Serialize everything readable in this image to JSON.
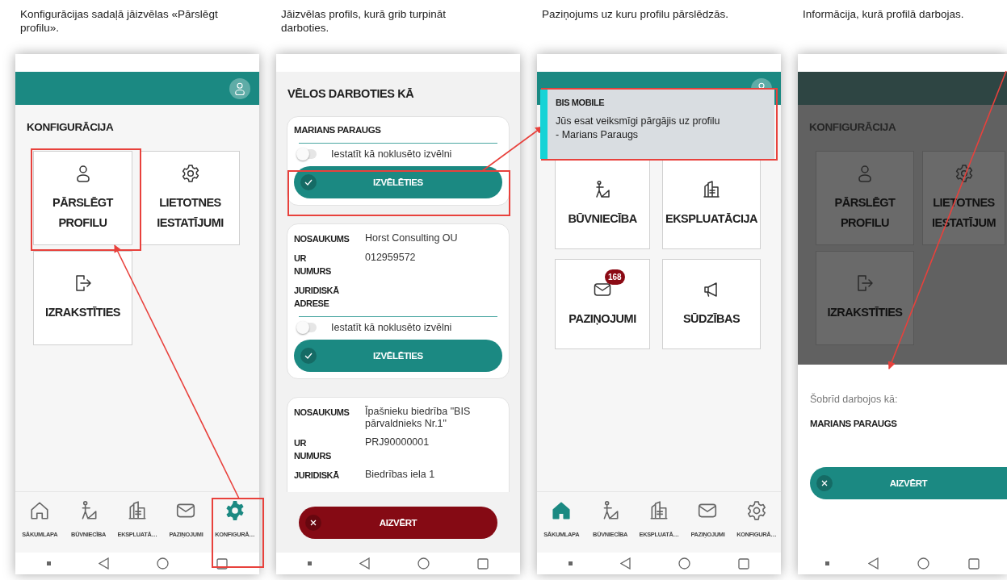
{
  "panels": [
    {
      "kind": "menu",
      "caption": "Konfigurācijas sadaļā jāizvēlas «Pārslēgt profilu».",
      "title": "KONFIGURĀCIJA",
      "tiles": [
        {
          "kind": "person",
          "label": "PĀRSLĒGT PROFILU"
        },
        {
          "kind": "gear",
          "label": "LIETOTNES IESTATĪJUMI"
        },
        {
          "kind": "logout",
          "label": "IZRAKSTĪTIES"
        }
      ],
      "nav": [
        {
          "kind": "home",
          "label": "SĀKUMLAPA",
          "selected": false
        },
        {
          "kind": "construction",
          "label": "BŪVNIECĪBA",
          "selected": false
        },
        {
          "kind": "building",
          "label": "EKSPLUATĀ…",
          "selected": false
        },
        {
          "kind": "envelope",
          "label": "PAZIŅOJUMI",
          "selected": false
        },
        {
          "kind": "gear",
          "label": "KONFIGURĀ…",
          "selected": true
        }
      ]
    },
    {
      "kind": "picker",
      "caption": "Jāizvēlas profils, kurā grib turpināt darboties.",
      "title": "VĒLOS DARBOTIES KĀ",
      "cards": [
        {
          "name": "MARIANS PARAUGS",
          "toggle": {
            "label": "Iestatīt kā noklusēto izvēlni",
            "checked": false
          },
          "button": "IZVĒLĒTIES"
        },
        {
          "fields": [
            {
              "label": "NOSAUKUMS",
              "value": "Horst Consulting OU"
            },
            {
              "label": "UR NUMURS",
              "value": "012959572"
            },
            {
              "label": "JURIDISKĀ ADRESE"
            }
          ],
          "toggle": {
            "label": "Iestatīt kā noklusēto izvēlni",
            "checked": false
          },
          "button": "IZVĒLĒTIES"
        },
        {
          "fields": [
            {
              "label": "NOSAUKUMS",
              "value": "Īpašnieku biedrība \"BIS pārvaldnieks Nr.1\""
            },
            {
              "label": "UR NUMURS",
              "value": "PRJ90000001"
            },
            {
              "label": "JURIDISKĀ",
              "value": "Biedrības iela 1"
            }
          ]
        }
      ],
      "close_button": "AIZVĒRT"
    },
    {
      "kind": "home",
      "caption": "Paziņojums uz kuru profilu pārslēdzās.",
      "notification": {
        "title": "BIS MOBILE",
        "message": "Jūs esat veiksmīgi pārgājis uz profilu\n - Marians Paraugs"
      },
      "tiles": [
        {
          "kind": "construction",
          "label": "BŪVNIECĪBA"
        },
        {
          "kind": "building",
          "label": "EKSPLUATĀCIJA"
        },
        {
          "kind": "envelope",
          "label": "PAZIŅOJUMI",
          "badge": "168"
        },
        {
          "kind": "megaphone",
          "label": "SŪDZĪBAS"
        }
      ],
      "nav": [
        {
          "kind": "home",
          "label": "SĀKUMLAPA",
          "selected": true
        },
        {
          "kind": "construction",
          "label": "BŪVNIECĪBA",
          "selected": false
        },
        {
          "kind": "building",
          "label": "EKSPLUATĀ…",
          "selected": false
        },
        {
          "kind": "envelope",
          "label": "PAZIŅOJUMI",
          "selected": false
        },
        {
          "kind": "gear",
          "label": "KONFIGURĀ…",
          "selected": false
        }
      ]
    },
    {
      "kind": "sheet",
      "caption": "Informācija, kurā profilā darbojas.",
      "title": "KONFIGURĀCIJA",
      "tiles": [
        {
          "kind": "person",
          "label": "PĀRSLĒGT PROFILU"
        },
        {
          "kind": "gear",
          "label": "LIETOTNES IESTATĪJUM"
        },
        {
          "kind": "logout",
          "label": "IZRAKSTĪTIES"
        }
      ],
      "sheet": {
        "label": "Šobrīd darbojos kā:",
        "profile": "MARIANS PARAUGS",
        "button": "AIZVĒRT"
      }
    }
  ]
}
